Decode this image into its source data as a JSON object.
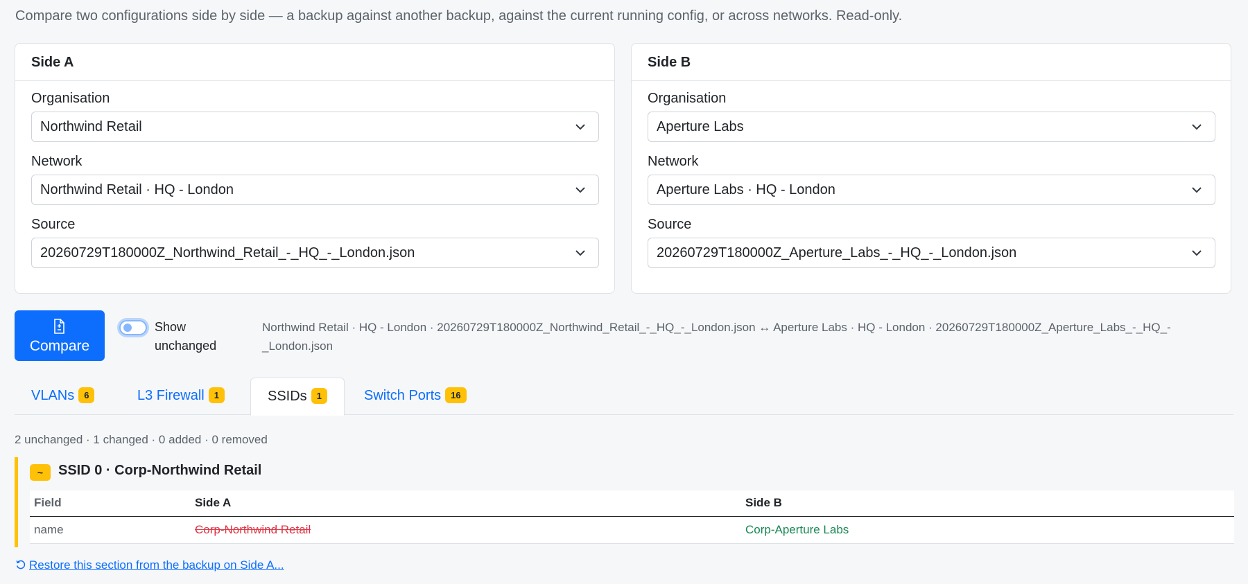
{
  "intro": "Compare two configurations side by side — a backup against another backup, against the current running config, or across networks. Read-only.",
  "side_a": {
    "title": "Side A",
    "org_label": "Organisation",
    "org_value": "Northwind Retail",
    "network_label": "Network",
    "network_value": "Northwind Retail · HQ - London",
    "source_label": "Source",
    "source_value": "20260729T180000Z_Northwind_Retail_-_HQ_-_London.json"
  },
  "side_b": {
    "title": "Side B",
    "org_label": "Organisation",
    "org_value": "Aperture Labs",
    "network_label": "Network",
    "network_value": "Aperture Labs · HQ - London",
    "source_label": "Source",
    "source_value": "20260729T180000Z_Aperture_Labs_-_HQ_-_London.json"
  },
  "actions": {
    "compare_label": "Compare",
    "compare_icon": "file-diff-icon",
    "toggle_label": "Show unchanged",
    "toggle_on": false
  },
  "comparison_summary": "Northwind Retail · HQ - London · 20260729T180000Z_Northwind_Retail_-_HQ_-_London.json ↔ Aperture Labs · HQ - London · 20260729T180000Z_Aperture_Labs_-_HQ_-_London.json",
  "tabs": [
    {
      "label": "VLANs",
      "count": "6",
      "active": false
    },
    {
      "label": "L3 Firewall",
      "count": "1",
      "active": false
    },
    {
      "label": "SSIDs",
      "count": "1",
      "active": true
    },
    {
      "label": "Switch Ports",
      "count": "16",
      "active": false
    }
  ],
  "counts": "2 unchanged · 1 changed · 0 added · 0 removed",
  "diff": {
    "status_symbol": "~",
    "title": "SSID 0 · Corp-Northwind Retail",
    "headers": {
      "field": "Field",
      "a": "Side A",
      "b": "Side B"
    },
    "rows": [
      {
        "field": "name",
        "a": "Corp-Northwind Retail",
        "b": "Corp-Aperture Labs"
      }
    ]
  },
  "restore": {
    "icon": "restore-icon",
    "label": "Restore this section from the backup on Side A..."
  },
  "colors": {
    "accent": "#0d6efd",
    "badge": "#ffc107",
    "removed": "#dc3545",
    "added": "#198754"
  }
}
